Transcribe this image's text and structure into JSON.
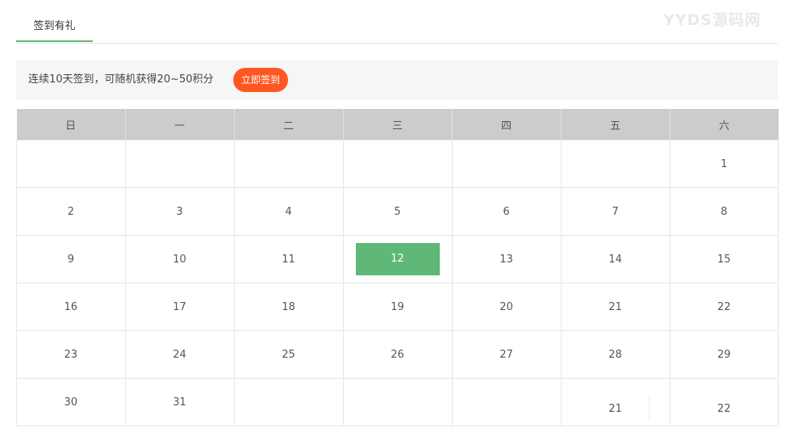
{
  "watermark": "YYDS源码网",
  "tab": {
    "label": "签到有礼"
  },
  "notice": {
    "text": "连续10天签到，可随机获得20~50积分",
    "button": "立即签到"
  },
  "calendar": {
    "weekdays": [
      "日",
      "一",
      "二",
      "三",
      "四",
      "五",
      "六"
    ],
    "highlight": "12",
    "weeks": [
      [
        "",
        "",
        "",
        "",
        "",
        "",
        "1"
      ],
      [
        "2",
        "3",
        "4",
        "5",
        "6",
        "7",
        "8"
      ],
      [
        "9",
        "10",
        "11",
        "12",
        "13",
        "14",
        "15"
      ],
      [
        "16",
        "17",
        "18",
        "19",
        "20",
        "21",
        "22"
      ],
      [
        "23",
        "24",
        "25",
        "26",
        "27",
        "28",
        "29"
      ],
      [
        "30",
        "31",
        "",
        "",
        "",
        "21",
        "22"
      ]
    ]
  },
  "colors": {
    "accent": "#5fb878",
    "button": "#ff5722",
    "header": "#cccccc"
  }
}
